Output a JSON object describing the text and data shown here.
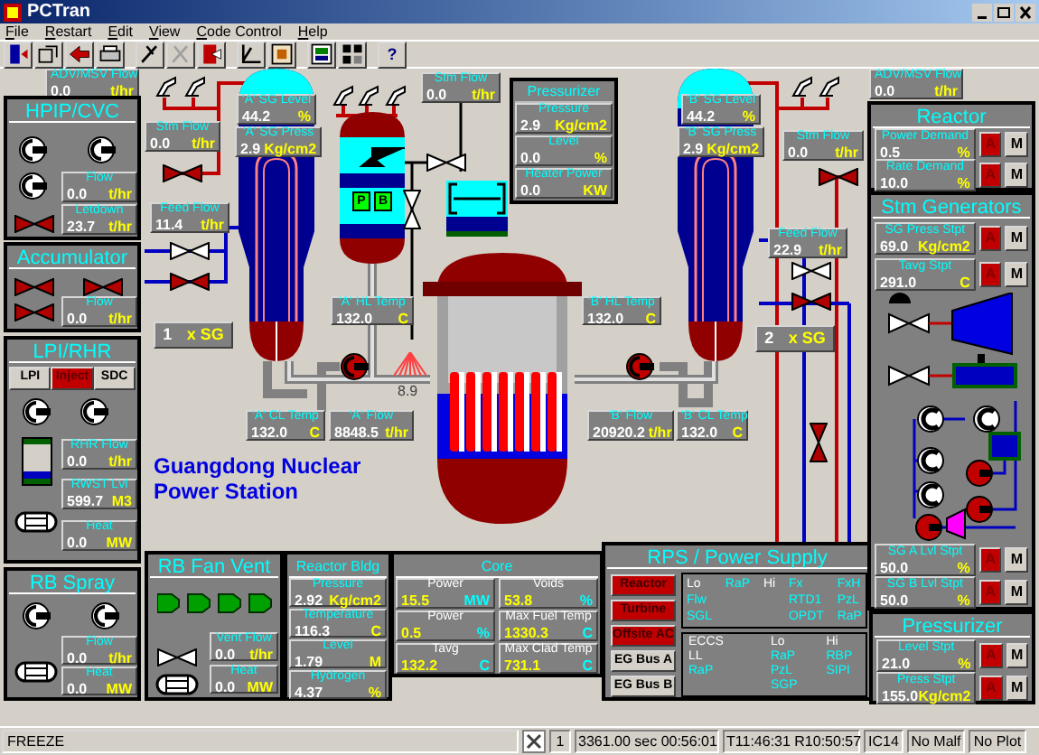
{
  "window": {
    "title": "PCTran"
  },
  "menu": [
    {
      "label": "File"
    },
    {
      "label": "Restart"
    },
    {
      "label": "Edit"
    },
    {
      "label": "View"
    },
    {
      "label": "Code Control"
    },
    {
      "label": "Help"
    }
  ],
  "toolbar": {
    "help_label": "?"
  },
  "adv_msv_flow_a": {
    "label": "ADV/MSV Flow",
    "value": "0.0",
    "unit": "t/hr"
  },
  "hpip_cvc": {
    "title": "HPIP/CVC",
    "readouts": [
      {
        "label": "Flow",
        "value": "0.0",
        "unit": "t/hr"
      },
      {
        "label": "Letdown",
        "value": "23.7",
        "unit": "t/hr"
      }
    ],
    "valves": [
      {
        "open": false
      }
    ]
  },
  "accumulator": {
    "title": "Accumulator",
    "readouts": [
      {
        "label": "Flow",
        "value": "0.0",
        "unit": "t/hr"
      }
    ],
    "valves": [
      {
        "open": false
      },
      {
        "open": false
      },
      {
        "open": false
      }
    ]
  },
  "lpi_rhr": {
    "title": "LPI/RHR",
    "tabs": [
      {
        "label": "LPI",
        "selected": false
      },
      {
        "label": "Inject",
        "selected": true
      },
      {
        "label": "SDC",
        "selected": false
      }
    ],
    "tank": {
      "level": 0.3
    },
    "readouts": [
      {
        "label": "RHR Flow",
        "value": "0.0",
        "unit": "t/hr"
      },
      {
        "label": "RWST Lvl",
        "value": "599.7",
        "unit": "M3"
      },
      {
        "label": "Heat",
        "value": "0.0",
        "unit": "MW"
      }
    ]
  },
  "rb_spray": {
    "title": "RB Spray",
    "readouts": [
      {
        "label": "Flow",
        "value": "0.0",
        "unit": "t/hr"
      },
      {
        "label": "Heat",
        "value": "0.0",
        "unit": "MW"
      }
    ]
  },
  "rb_fan_vent": {
    "title": "RB Fan  Vent",
    "valves": [
      {
        "open": true
      }
    ],
    "readouts": [
      {
        "label": "Vent Flow",
        "value": "0.0",
        "unit": "t/hr"
      },
      {
        "label": "Heat",
        "value": "0.0",
        "unit": "MW"
      }
    ]
  },
  "reactor_bldg": {
    "title": "Reactor Bldg",
    "readouts": [
      {
        "label": "Pressure",
        "value": "2.92",
        "unit": "Kg/cm2"
      },
      {
        "label": "Temperature",
        "value": "116.3",
        "unit": "C"
      },
      {
        "label": "Level",
        "value": "1.79",
        "unit": "M"
      },
      {
        "label": "Hydrogen",
        "value": "4.37",
        "unit": "%"
      }
    ]
  },
  "core": {
    "title": "Core",
    "readouts": [
      {
        "label": "Power",
        "value": "15.5",
        "unit": "MW"
      },
      {
        "label": "Voids",
        "value": "53.8",
        "unit": "%"
      },
      {
        "label": "Power",
        "value": "0.5",
        "unit": "%"
      },
      {
        "label": "Max Fuel Temp",
        "value": "1330.3",
        "unit": "C"
      },
      {
        "label": "Tavg",
        "value": "132.2",
        "unit": "C"
      },
      {
        "label": "Max Clad Temp",
        "value": "731.1",
        "unit": "C"
      }
    ]
  },
  "rps_power_supply": {
    "title": "RPS / Power Supply",
    "buttons": [
      {
        "label": "Reactor",
        "tripped": true
      },
      {
        "label": "Turbine",
        "tripped": true
      },
      {
        "label": "Offsite AC",
        "tripped": true
      },
      {
        "label": "EG Bus A",
        "tripped": false
      },
      {
        "label": "EG Bus B",
        "tripped": false
      }
    ],
    "trip_signal_columns": [
      [
        "Lo",
        "Flw",
        "SGL"
      ],
      [
        "RaP"
      ],
      [
        "Hi"
      ],
      [
        "Fx",
        "RTD1",
        "OPDT"
      ],
      [
        "FxH",
        "PzL",
        "RaP"
      ]
    ],
    "eccs_signal_columns": [
      [
        "ECCS",
        "LL",
        "RaP"
      ],
      [
        "Lo",
        "RaP",
        "PzL",
        "SGP"
      ],
      [
        "Hi",
        "RBP",
        "SIPI"
      ]
    ]
  },
  "adv_msv_flow_b": {
    "label": "ADV/MSV Flow",
    "value": "0.0",
    "unit": "t/hr"
  },
  "reactor": {
    "title": "Reactor",
    "controls": [
      {
        "label": "Power Demand",
        "value": "0.5",
        "unit": "%",
        "auto_label": "A",
        "manual_label": "M",
        "auto": true
      },
      {
        "label": "Rate Demand",
        "value": "10.0",
        "unit": "%",
        "auto_label": "A",
        "manual_label": "M",
        "auto": true
      }
    ]
  },
  "stm_generators": {
    "title": "Stm Generators",
    "controls": [
      {
        "label": "SG Press Stpt",
        "value": "69.0",
        "unit": "Kg/cm2",
        "auto_label": "A",
        "manual_label": "M",
        "auto": true
      },
      {
        "label": "Tavg Stpt",
        "value": "291.0",
        "unit": "C",
        "auto_label": "A",
        "manual_label": "M",
        "auto": true
      },
      {
        "label": "SG A Lvl Stpt",
        "value": "50.0",
        "unit": "%",
        "auto_label": "A",
        "manual_label": "M",
        "auto": true
      },
      {
        "label": "SG B Lvl Stpt",
        "value": "50.0",
        "unit": "%",
        "auto_label": "A",
        "manual_label": "M",
        "auto": true
      }
    ]
  },
  "pressurizer_control": {
    "title": "Pressurizer",
    "controls": [
      {
        "label": "Level Stpt",
        "value": "21.0",
        "unit": "%",
        "auto_label": "A",
        "manual_label": "M",
        "auto": true
      },
      {
        "label": "Press Stpt",
        "value": "155.0",
        "unit": "Kg/cm2",
        "auto_label": "A",
        "manual_label": "M",
        "auto": true
      }
    ]
  },
  "loop_a": {
    "sg_level": {
      "label": "'A' SG Level",
      "value": "44.2",
      "unit": "%"
    },
    "sg_press": {
      "label": "'A' SG Press",
      "value": "2.9",
      "unit": "Kg/cm2"
    },
    "stm_flow": {
      "label": "Stm Flow",
      "value": "0.0",
      "unit": "t/hr"
    },
    "feed_flow": {
      "label": "Feed Flow",
      "value": "11.4",
      "unit": "t/hr"
    },
    "sg_count": {
      "value": "1",
      "label": "x SG"
    },
    "hl_temp": {
      "label": "'A' HL Temp",
      "value": "132.0",
      "unit": "C"
    },
    "cl_temp": {
      "label": "'A' CL Temp",
      "value": "132.0",
      "unit": "C"
    },
    "flow": {
      "label": "'A' Flow",
      "value": "8848.5",
      "unit": "t/hr"
    },
    "valves": [
      {
        "open": false
      },
      {
        "open": true
      },
      {
        "open": false
      }
    ]
  },
  "loop_b": {
    "sg_level": {
      "label": "'B' SG Level",
      "value": "44.2",
      "unit": "%"
    },
    "sg_press": {
      "label": "'B' SG Press",
      "value": "2.9",
      "unit": "Kg/cm2"
    },
    "stm_flow": {
      "label": "Stm Flow",
      "value": "0.0",
      "unit": "t/hr"
    },
    "feed_flow": {
      "label": "Feed Flow",
      "value": "22.9",
      "unit": "t/hr"
    },
    "sg_count": {
      "value": "2",
      "label": "x SG"
    },
    "hl_temp": {
      "label": "'B' HL Temp",
      "value": "132.0",
      "unit": "C"
    },
    "cl_temp": {
      "label": "'B' CL Temp",
      "value": "132.0",
      "unit": "C"
    },
    "flow": {
      "label": "'B' Flow",
      "value": "20920.2",
      "unit": "t/hr"
    },
    "valves": [
      {
        "open": false
      },
      {
        "open": true
      },
      {
        "open": false
      },
      {
        "open": false
      }
    ]
  },
  "center_stm_flow": {
    "label": "Stm Flow",
    "value": "0.0",
    "unit": "t/hr"
  },
  "pressurizer": {
    "title": "Pressurizer",
    "readouts": [
      {
        "label": "Pressure",
        "value": "2.9",
        "unit": "Kg/cm2"
      },
      {
        "label": "Level",
        "value": "0.0",
        "unit": "%"
      },
      {
        "label": "Heater Power",
        "value": "0.0",
        "unit": "KW"
      }
    ],
    "heaters": [
      {
        "label": "P"
      },
      {
        "label": "B"
      }
    ],
    "valves": [
      {
        "open": true
      },
      {
        "open": true
      }
    ]
  },
  "break_flow": "8.9",
  "plant_name": "Guangdong Nuclear Power Station",
  "status_bar": {
    "mode": "FREEZE",
    "count": "1",
    "time": "3361.00 sec  00:56:01",
    "clock": "T11:46:31 R10:50:57",
    "ic": "IC14",
    "malf": "No Malf",
    "plot": "No Plot"
  }
}
